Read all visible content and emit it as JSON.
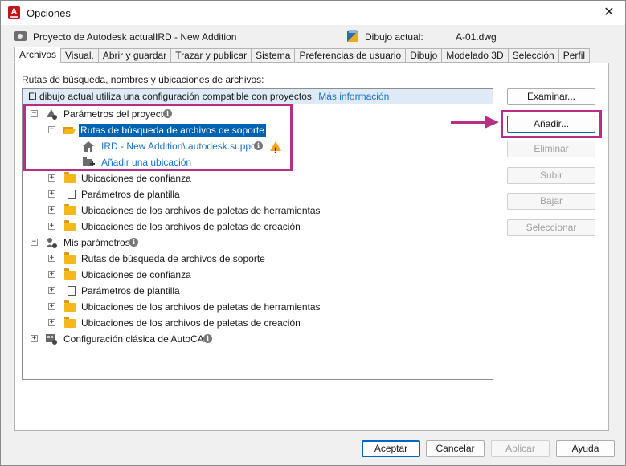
{
  "window": {
    "title": "Opciones",
    "close_glyph": "✕"
  },
  "info": {
    "project_label": "Proyecto de Autodesk actual:",
    "project_value": "IRD - New Addition",
    "drawing_label": "Dibujo actual:",
    "drawing_value": "A-01.dwg"
  },
  "tabs": [
    {
      "label": "Archivos",
      "active": true
    },
    {
      "label": "Visual."
    },
    {
      "label": "Abrir y guardar"
    },
    {
      "label": "Trazar y publicar"
    },
    {
      "label": "Sistema"
    },
    {
      "label": "Preferencias de usuario"
    },
    {
      "label": "Dibujo"
    },
    {
      "label": "Modelado 3D"
    },
    {
      "label": "Selección"
    },
    {
      "label": "Perfil"
    }
  ],
  "panel": {
    "label": "Rutas de búsqueda, nombres y ubicaciones de archivos:",
    "notice_text": "El dibujo actual utiliza una configuración compatible con proyectos.",
    "notice_link": "Más información"
  },
  "tree": {
    "project_params": "Parámetros del proyecto",
    "support_paths": "Rutas de búsqueda de archivos de soporte",
    "ird_support": "IRD - New Addition\\.autodesk.support",
    "add_location": "Añadir una ubicación",
    "trusted_locations": "Ubicaciones de confianza",
    "template_params": "Parámetros de plantilla",
    "tool_palettes": "Ubicaciones de los archivos de paletas de herramientas",
    "creation_palettes": "Ubicaciones de los archivos de paletas de creación",
    "my_params": "Mis parámetros",
    "my_support_paths": "Rutas de búsqueda de archivos de soporte",
    "my_trusted_locations": "Ubicaciones de confianza",
    "my_template_params": "Parámetros de plantilla",
    "my_tool_palettes": "Ubicaciones de los archivos de paletas de herramientas",
    "my_creation_palettes": "Ubicaciones de los archivos de paletas de creación",
    "classic_config": "Configuración clásica de AutoCAD",
    "expand_glyph": "+",
    "collapse_glyph": "−",
    "info_glyph": "i"
  },
  "side_buttons": {
    "browse": "Examinar...",
    "add": "Añadir...",
    "remove": "Eliminar",
    "up": "Subir",
    "down": "Bajar",
    "select": "Seleccionar"
  },
  "bottom_buttons": {
    "ok": "Aceptar",
    "cancel": "Cancelar",
    "apply": "Aplicar",
    "help": "Ayuda"
  },
  "colors": {
    "accent": "#0063b1",
    "highlight_annotation": "#b72e84",
    "link": "#1a73c7",
    "folder": "#f3b91b"
  },
  "icons": [
    "autocad-app-icon",
    "project-icon",
    "drawing-icon",
    "folder-icon",
    "open-folder-icon",
    "house-icon",
    "add-location-icon",
    "template-icon",
    "info-icon",
    "warning-icon",
    "user-settings-icon",
    "classic-config-icon"
  ]
}
